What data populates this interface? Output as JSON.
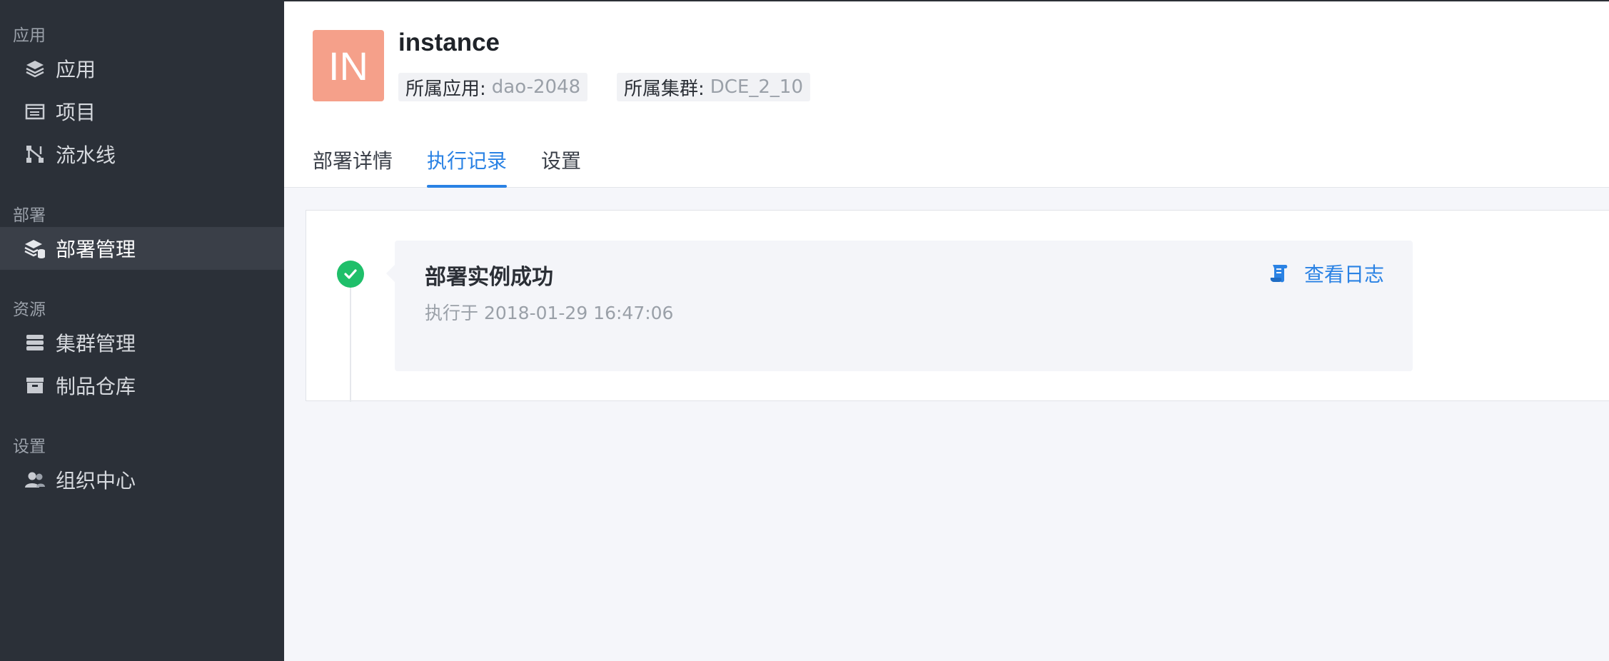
{
  "sidebar": {
    "sections": [
      {
        "title": "应用",
        "items": [
          {
            "label": "应用",
            "icon": "layers-icon"
          },
          {
            "label": "项目",
            "icon": "folder-icon"
          },
          {
            "label": "流水线",
            "icon": "pipeline-icon"
          }
        ]
      },
      {
        "title": "部署",
        "items": [
          {
            "label": "部署管理",
            "icon": "deploy-stack-icon",
            "active": true
          }
        ]
      },
      {
        "title": "资源",
        "items": [
          {
            "label": "集群管理",
            "icon": "server-stack-icon"
          },
          {
            "label": "制品仓库",
            "icon": "box-icon"
          }
        ]
      },
      {
        "title": "设置",
        "items": [
          {
            "label": "组织中心",
            "icon": "users-icon"
          }
        ]
      }
    ]
  },
  "header": {
    "avatar_text": "IN",
    "avatar_color": "#f5a08a",
    "name": "instance",
    "app_key": "所属应用:",
    "app_value": "dao-2048",
    "cluster_key": "所属集群:",
    "cluster_value": "DCE_2_10"
  },
  "tabs": [
    {
      "label": "部署详情",
      "active": false
    },
    {
      "label": "执行记录",
      "active": true
    },
    {
      "label": "设置",
      "active": false
    }
  ],
  "records": [
    {
      "title": "部署实例成功",
      "time": "执行于 2018-01-29 16:47:06",
      "status": "success",
      "status_color": "#1fbf6a",
      "action_label": "查看日志",
      "action_icon": "scroll-log-icon"
    }
  ],
  "colors": {
    "accent": "#2a82e4",
    "sidebar_bg": "#2b3038"
  }
}
